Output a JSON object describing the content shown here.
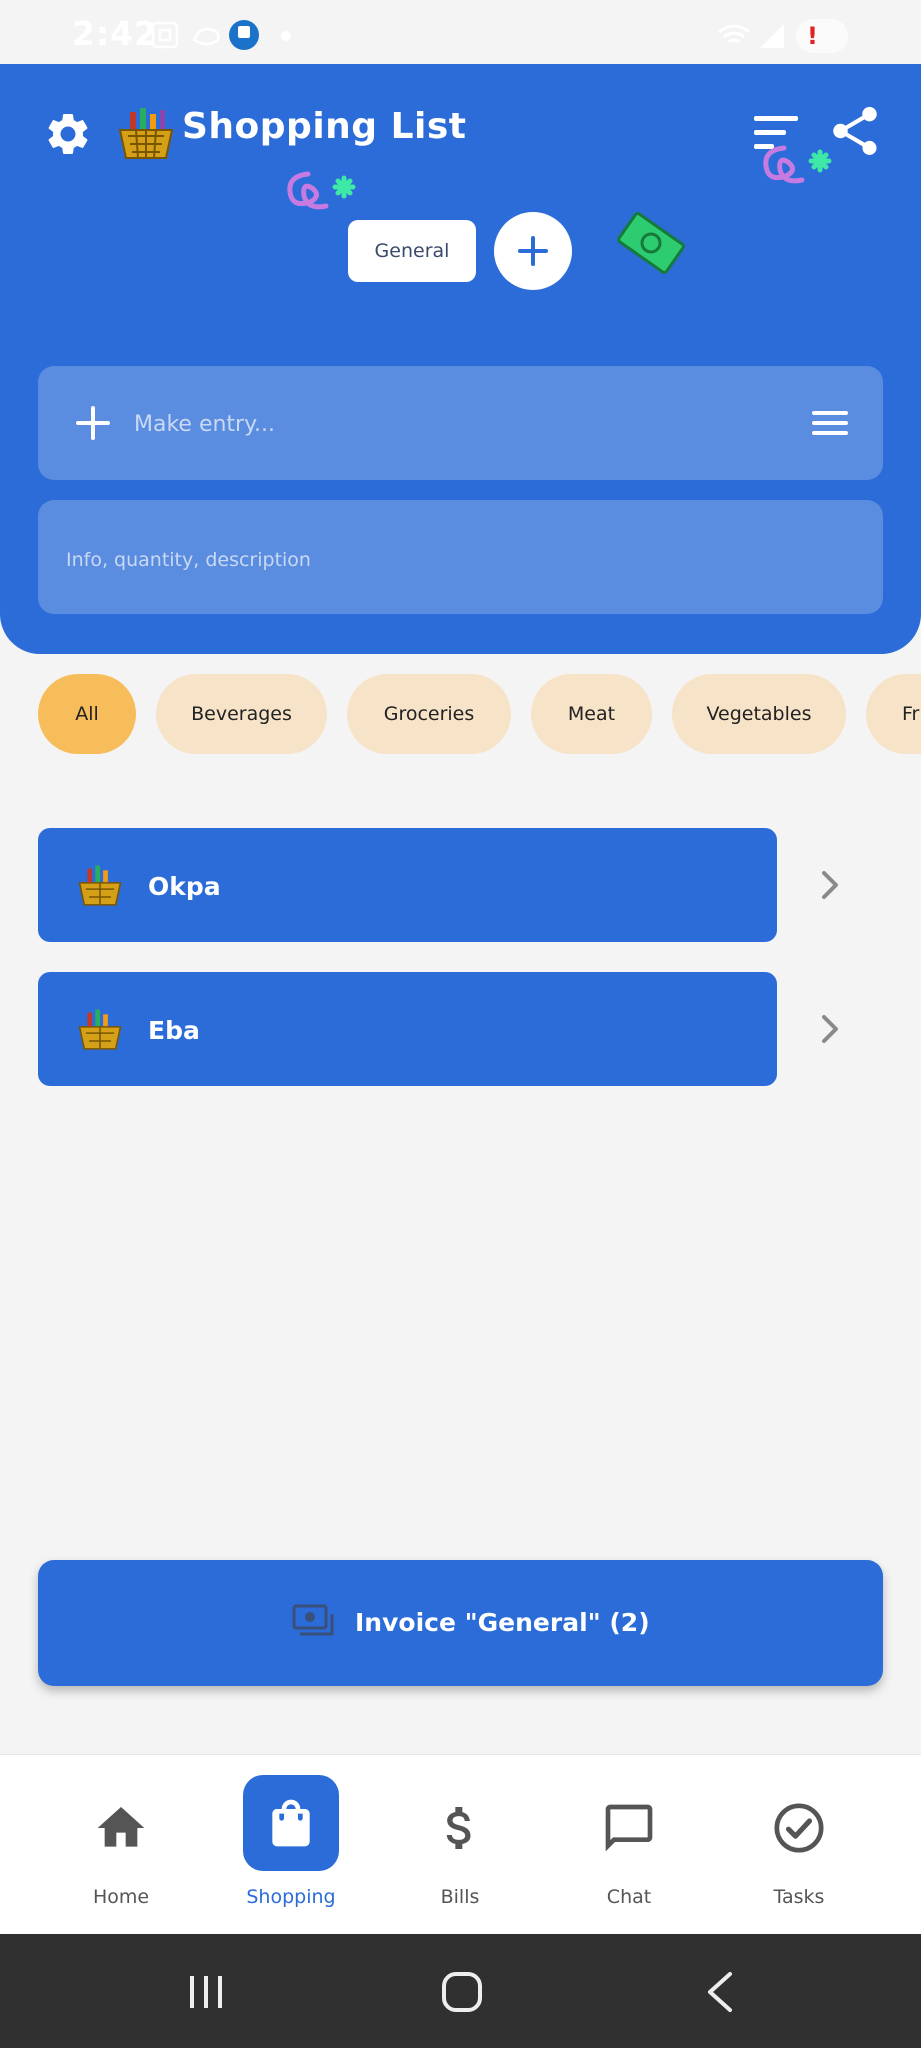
{
  "status_bar": {
    "time": "2:42"
  },
  "header": {
    "title": "Shopping List",
    "list_chip": "General",
    "entry_placeholder": "Make entry...",
    "info_placeholder": "Info, quantity, description"
  },
  "categories": [
    {
      "label": "All",
      "active": true
    },
    {
      "label": "Beverages",
      "active": false
    },
    {
      "label": "Groceries",
      "active": false
    },
    {
      "label": "Meat",
      "active": false
    },
    {
      "label": "Vegetables",
      "active": false
    },
    {
      "label": "Fr",
      "active": false
    }
  ],
  "items": [
    {
      "label": "Okpa"
    },
    {
      "label": "Eba"
    }
  ],
  "invoice": {
    "label": "Invoice \"General\" (2)"
  },
  "bottom_nav": [
    {
      "label": "Home",
      "icon": "home-icon"
    },
    {
      "label": "Shopping",
      "icon": "shopping-bag-icon",
      "active": true
    },
    {
      "label": "Bills",
      "icon": "dollar-icon"
    },
    {
      "label": "Chat",
      "icon": "chat-icon"
    },
    {
      "label": "Tasks",
      "icon": "check-circle-icon"
    }
  ],
  "colors": {
    "primary": "#2b6cd8",
    "field": "#5a8ce0",
    "chip": "#f6e3c8",
    "chip_active": "#f7bd5b",
    "background": "#f4f4f4"
  }
}
